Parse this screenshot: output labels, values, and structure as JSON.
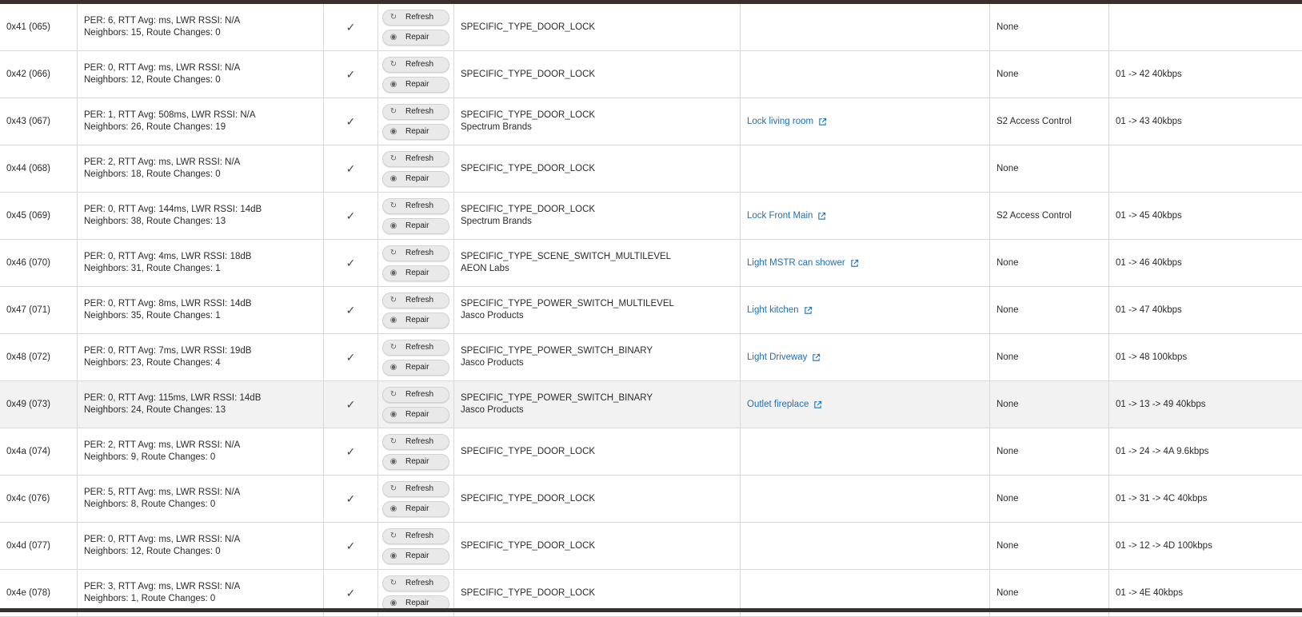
{
  "buttons": {
    "refresh": "Refresh",
    "repair": "Repair"
  },
  "rows": [
    {
      "id": "0x41 (065)",
      "stats1": "PER: 6, RTT Avg: ms, LWR RSSI: N/A",
      "stats2": "Neighbors: 15, Route Changes: 0",
      "type": "SPECIFIC_TYPE_DOOR_LOCK",
      "mfr": "",
      "device": "",
      "security": "None",
      "route": ""
    },
    {
      "id": "0x42 (066)",
      "stats1": "PER: 0, RTT Avg: ms, LWR RSSI: N/A",
      "stats2": "Neighbors: 12, Route Changes: 0",
      "type": "SPECIFIC_TYPE_DOOR_LOCK",
      "mfr": "",
      "device": "",
      "security": "None",
      "route": "01 -> 42 40kbps"
    },
    {
      "id": "0x43 (067)",
      "stats1": "PER: 1, RTT Avg: 508ms, LWR RSSI: N/A",
      "stats2": "Neighbors: 26, Route Changes: 19",
      "type": "SPECIFIC_TYPE_DOOR_LOCK",
      "mfr": "Spectrum Brands",
      "device": "Lock living room",
      "security": "S2 Access Control",
      "route": "01 -> 43 40kbps"
    },
    {
      "id": "0x44 (068)",
      "stats1": "PER: 2, RTT Avg: ms, LWR RSSI: N/A",
      "stats2": "Neighbors: 18, Route Changes: 0",
      "type": "SPECIFIC_TYPE_DOOR_LOCK",
      "mfr": "",
      "device": "",
      "security": "None",
      "route": ""
    },
    {
      "id": "0x45 (069)",
      "stats1": "PER: 0, RTT Avg: 144ms, LWR RSSI: 14dB",
      "stats2": "Neighbors: 38, Route Changes: 13",
      "type": "SPECIFIC_TYPE_DOOR_LOCK",
      "mfr": "Spectrum Brands",
      "device": "Lock Front Main",
      "security": "S2 Access Control",
      "route": "01 -> 45 40kbps"
    },
    {
      "id": "0x46 (070)",
      "stats1": "PER: 0, RTT Avg: 4ms, LWR RSSI: 18dB",
      "stats2": "Neighbors: 31, Route Changes: 1",
      "type": "SPECIFIC_TYPE_SCENE_SWITCH_MULTILEVEL",
      "mfr": "AEON Labs",
      "device": "Light MSTR can shower",
      "security": "None",
      "route": "01 -> 46 40kbps"
    },
    {
      "id": "0x47 (071)",
      "stats1": "PER: 0, RTT Avg: 8ms, LWR RSSI: 14dB",
      "stats2": "Neighbors: 35, Route Changes: 1",
      "type": "SPECIFIC_TYPE_POWER_SWITCH_MULTILEVEL",
      "mfr": "Jasco Products",
      "device": "Light kitchen",
      "security": "None",
      "route": "01 -> 47 40kbps"
    },
    {
      "id": "0x48 (072)",
      "stats1": "PER: 0, RTT Avg: 7ms, LWR RSSI: 19dB",
      "stats2": "Neighbors: 23, Route Changes: 4",
      "type": "SPECIFIC_TYPE_POWER_SWITCH_BINARY",
      "mfr": "Jasco Products",
      "device": "Light Driveway",
      "security": "None",
      "route": "01 -> 48 100kbps"
    },
    {
      "id": "0x49 (073)",
      "stats1": "PER: 0, RTT Avg: 115ms, LWR RSSI: 14dB",
      "stats2": "Neighbors: 24, Route Changes: 13",
      "type": "SPECIFIC_TYPE_POWER_SWITCH_BINARY",
      "mfr": "Jasco Products",
      "device": "Outlet fireplace",
      "security": "None",
      "route": "01 -> 13 -> 49 40kbps",
      "highlight": true
    },
    {
      "id": "0x4a (074)",
      "stats1": "PER: 2, RTT Avg: ms, LWR RSSI: N/A",
      "stats2": "Neighbors: 9, Route Changes: 0",
      "type": "SPECIFIC_TYPE_DOOR_LOCK",
      "mfr": "",
      "device": "",
      "security": "None",
      "route": "01 -> 24 -> 4A 9.6kbps"
    },
    {
      "id": "0x4c (076)",
      "stats1": "PER: 5, RTT Avg: ms, LWR RSSI: N/A",
      "stats2": "Neighbors: 8, Route Changes: 0",
      "type": "SPECIFIC_TYPE_DOOR_LOCK",
      "mfr": "",
      "device": "",
      "security": "None",
      "route": "01 -> 31 -> 4C 40kbps"
    },
    {
      "id": "0x4d (077)",
      "stats1": "PER: 0, RTT Avg: ms, LWR RSSI: N/A",
      "stats2": "Neighbors: 12, Route Changes: 0",
      "type": "SPECIFIC_TYPE_DOOR_LOCK",
      "mfr": "",
      "device": "",
      "security": "None",
      "route": "01 -> 12 -> 4D 100kbps"
    },
    {
      "id": "0x4e (078)",
      "stats1": "PER: 3, RTT Avg: ms, LWR RSSI: N/A",
      "stats2": "Neighbors: 1, Route Changes: 0",
      "type": "SPECIFIC_TYPE_DOOR_LOCK",
      "mfr": "",
      "device": "",
      "security": "None",
      "route": "01 -> 4E 40kbps"
    }
  ],
  "icons": {
    "status": "checkmark-icon",
    "refresh": "refresh-icon",
    "repair": "repair-icon",
    "external": "external-link-icon"
  },
  "colors": {
    "link": "#1f6fb5",
    "frame": "#3a302b",
    "highlight_row": "#f2f2f2"
  }
}
